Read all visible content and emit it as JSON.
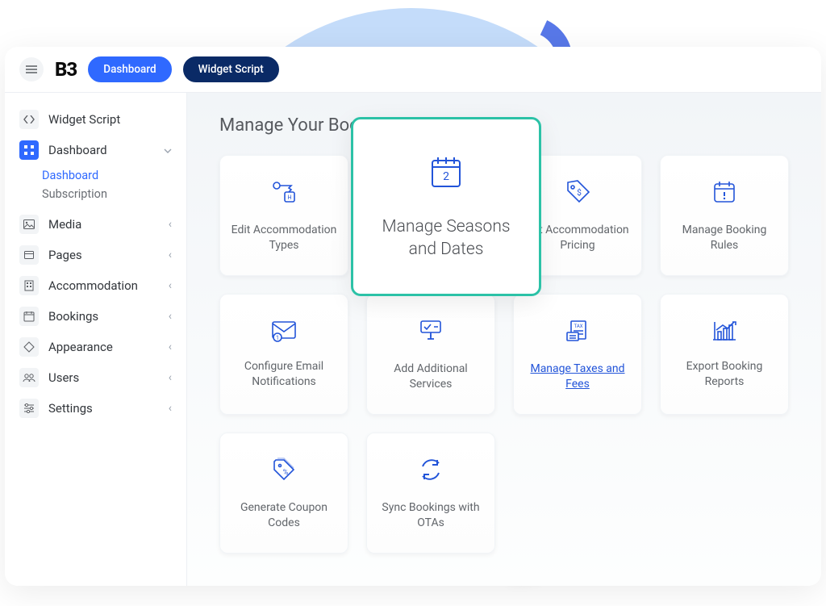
{
  "logo": "B3",
  "header": {
    "dashboard_label": "Dashboard",
    "widget_label": "Widget Script"
  },
  "sidebar": {
    "widget_script": "Widget Script",
    "dashboard": "Dashboard",
    "sub_dashboard": "Dashboard",
    "sub_subscription": "Subscription",
    "media": "Media",
    "pages": "Pages",
    "accommodation": "Accommodation",
    "bookings": "Bookings",
    "appearance": "Appearance",
    "users": "Users",
    "settings": "Settings"
  },
  "main": {
    "title": "Manage Your Booking Engine",
    "cards": {
      "edit_accom": "Edit Accommodation Types",
      "manage_seasons": "Manage Seasons and Dates",
      "set_pricing": "Set Accommodation Pricing",
      "booking_rules": "Manage Booking Rules",
      "email_notifications": "Configure Email Notifications",
      "additional_services": "Add Additional Services",
      "taxes_fees": "Manage Taxes and Fees",
      "export_reports": "Export Booking Reports",
      "coupon_codes": "Generate Coupon Codes",
      "sync_otas": "Sync Bookings with OTAs"
    }
  }
}
